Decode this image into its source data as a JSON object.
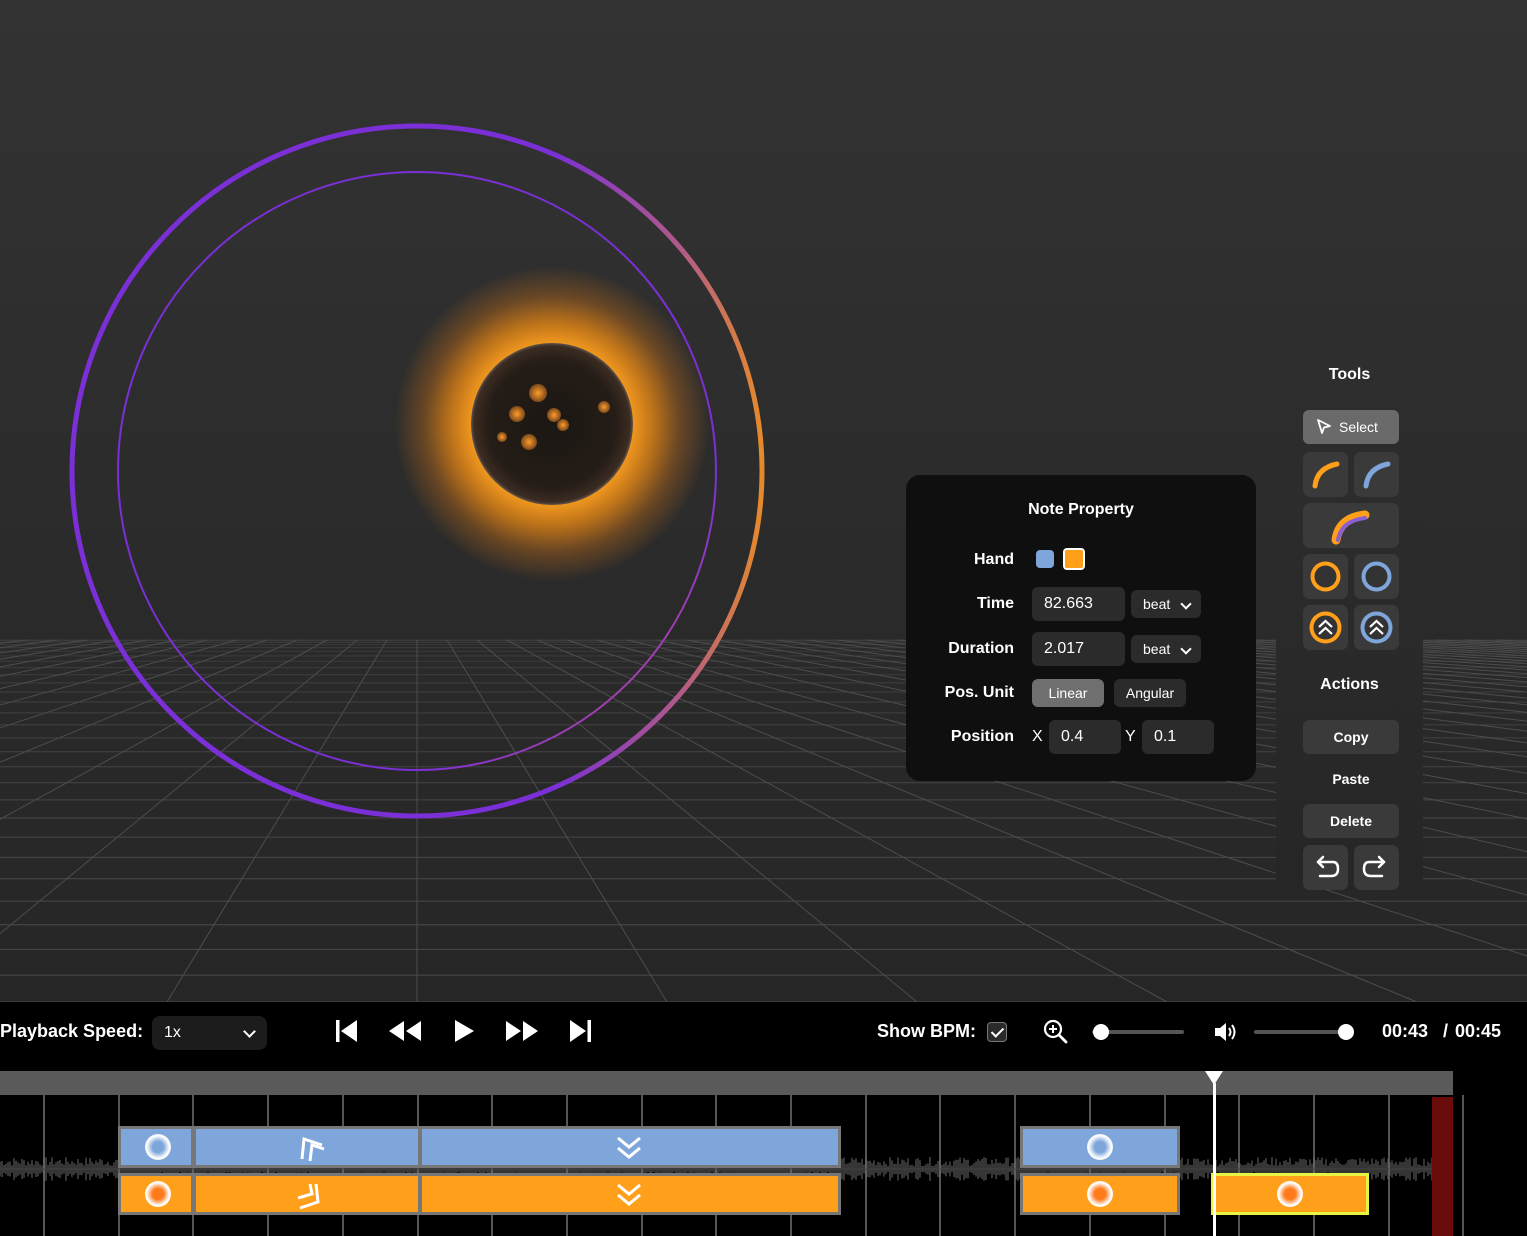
{
  "note_property": {
    "title": "Note Property",
    "hand_label": "Hand",
    "hand_colors": [
      "#7ea6da",
      "#ff9f1a"
    ],
    "selected_hand": "orange",
    "time_label": "Time",
    "time_value": "82.663",
    "time_unit": "beat",
    "duration_label": "Duration",
    "duration_value": "2.017",
    "duration_unit": "beat",
    "pos_unit_label": "Pos. Unit",
    "pos_unit_options": [
      "Linear",
      "Angular"
    ],
    "pos_unit_selected": "Linear",
    "position_label": "Position",
    "x_label": "X",
    "x_value": "0.4",
    "y_label": "Y",
    "y_value": "0.1"
  },
  "tools": {
    "title": "Tools",
    "select_label": "Select",
    "items": [
      "select-arrow-icon",
      "orange-arc-icon",
      "blue-arc-icon",
      "dual-arc-icon",
      "orange-tap-icon",
      "blue-tap-icon",
      "orange-flick-icon",
      "blue-flick-icon"
    ]
  },
  "actions": {
    "title": "Actions",
    "copy": "Copy",
    "paste": "Paste",
    "delete": "Delete"
  },
  "transport": {
    "playback_speed_label": "Playback Speed:",
    "playback_speed_value": "1x",
    "show_bpm_label": "Show BPM:",
    "show_bpm_checked": true,
    "zoom_level": 0.1,
    "volume_level": 1.0,
    "current_time": "00:43",
    "time_separator": "/",
    "total_time": "00:45"
  },
  "colors": {
    "left_hand": "#7ea6da",
    "right_hand": "#ff9f1a",
    "ring_purple": "#7b2fd6",
    "selection": "#e8f442"
  }
}
